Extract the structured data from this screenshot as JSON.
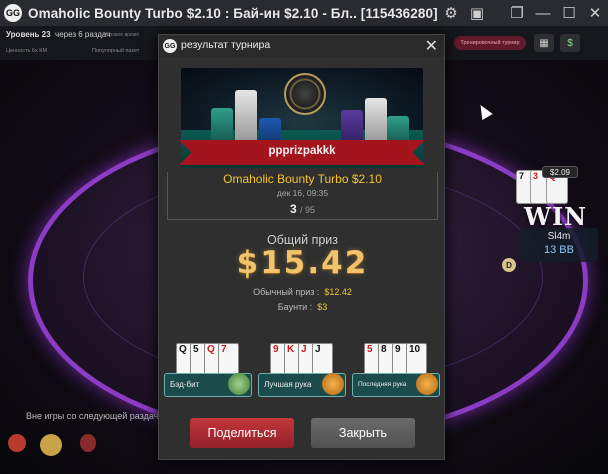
{
  "window": {
    "title": "Omaholic Bounty Turbo $2.10 : Бай-ин $2.10 - Бл.. [115436280]"
  },
  "subbar": {
    "level": "Уровень 23",
    "level_next": "через 6 раздач",
    "level_small": "Игровое время",
    "values_left": "Ценность 6х КМ",
    "values_right": "Популярный пакет",
    "button": "Тренировочный турнир"
  },
  "seat": {
    "cards": [
      "7",
      "3",
      "Q"
    ],
    "bet": "$2.09",
    "win": "WIN",
    "name": "Sl4m",
    "stack": "13 BB"
  },
  "out_text": "Вне игры со следующей раздачи",
  "modal": {
    "title": "результат турнира",
    "close_icon": "close-icon",
    "player": "ppprizрakkk",
    "tournament": "Omaholic Bounty Turbo $2.10",
    "date": "дек 16, 09:35",
    "place": "3",
    "place_of": "/ 95",
    "prize_label": "Общий приз",
    "prize_value": "$15.42",
    "regular_label": "Обычный приз :",
    "regular_value": "$12.42",
    "bounty_label": "Баунти :",
    "bounty_value": "$3",
    "awards": [
      {
        "label": "Бэд-бит",
        "cards": [
          "Q",
          "5",
          "Q",
          "7"
        ]
      },
      {
        "label": "Лучшая рука",
        "cards": [
          "9",
          "K",
          "J",
          "J"
        ]
      },
      {
        "label": "Последняя рука",
        "cards": [
          "5",
          "8",
          "9",
          "10"
        ]
      }
    ],
    "share_button": "Поделиться",
    "close_button": "Закрыть"
  },
  "colors": {
    "accent_gold": "#f4c431",
    "ribbon_red": "#a3141d",
    "felt_border": "#8c3cc4",
    "share_red": "#c2373b"
  }
}
